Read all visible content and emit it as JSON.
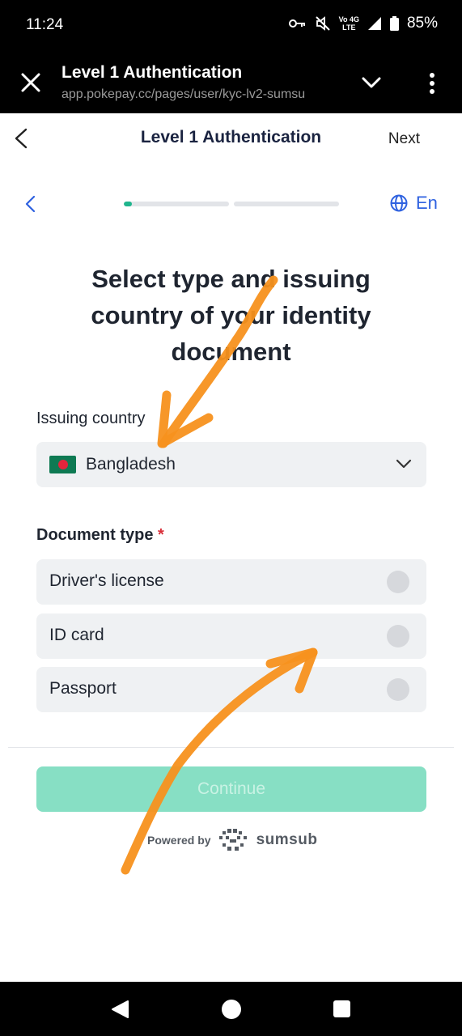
{
  "status_bar": {
    "time": "11:24",
    "network_label_top": "Vo 4G",
    "network_label_bottom": "LTE",
    "battery": "85%",
    "icons": [
      "key-icon",
      "mute-icon",
      "network-icon",
      "signal-icon",
      "battery-icon"
    ]
  },
  "browser": {
    "title": "Level 1 Authentication",
    "url": "app.pokepay.cc/pages/user/kyc-lv2-sumsu",
    "icons": [
      "close-icon",
      "chevron-down-icon",
      "more-vert-icon"
    ]
  },
  "header": {
    "title": "Level 1 Authentication",
    "next_label": "Next"
  },
  "progress": {
    "segments": 2,
    "current_fill_fraction": 0.08
  },
  "language": {
    "label": "En"
  },
  "heading": "Select type and issuing country of your identity document",
  "country": {
    "label": "Issuing country",
    "value": "Bangladesh"
  },
  "document_type": {
    "label": "Document type",
    "required_mark": "*",
    "options": [
      {
        "label": "Driver's license",
        "selected": false
      },
      {
        "label": "ID card",
        "selected": false
      },
      {
        "label": "Passport",
        "selected": false
      }
    ]
  },
  "continue_label": "Continue",
  "powered_by": {
    "text": "Powered by",
    "brand": "sumsub"
  },
  "colors": {
    "accent": "#1fb58d",
    "continue_disabled": "#87dfc4",
    "link_blue": "#2f62e0",
    "annotation_orange": "#f7911e",
    "required_red": "#d9303a"
  }
}
